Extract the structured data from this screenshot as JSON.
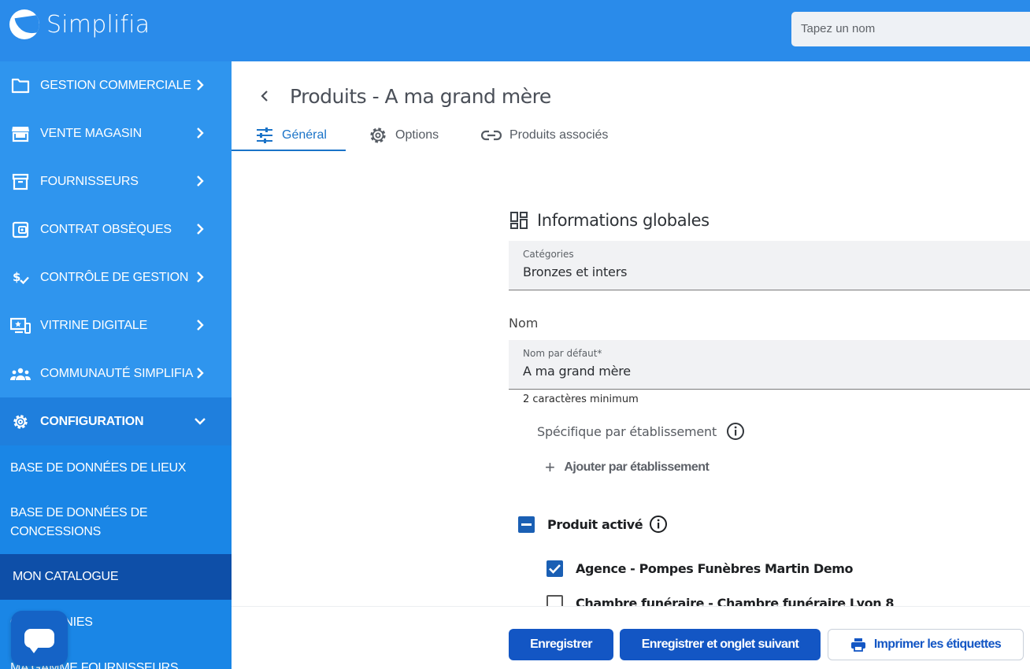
{
  "app": {
    "name": "Simplifia"
  },
  "search": {
    "placeholder": "Tapez un nom"
  },
  "sidebar": {
    "items": [
      {
        "label": "GESTION COMMERCIALE"
      },
      {
        "label": "VENTE MAGASIN"
      },
      {
        "label": "FOURNISSEURS"
      },
      {
        "label": "CONTRAT OBSÈQUES"
      },
      {
        "label": "CONTRÔLE DE GESTION"
      },
      {
        "label": "VITRINE DIGITALE"
      },
      {
        "label": "COMMUNAUTÉ SIMPLIFIA"
      },
      {
        "label": "CONFIGURATION"
      }
    ],
    "sub_items": [
      {
        "label": "BASE DE DONNÉES DE LIEUX"
      },
      {
        "label": "BASE DE DONNÉES DE CONCESSIONS"
      },
      {
        "label": "MON CATALOGUE"
      },
      {
        "label": "CÉRÉMONIES"
      },
      {
        "label": "MA GAMME FOURNISSEURS"
      }
    ]
  },
  "page": {
    "title": "Produits - A ma grand mère",
    "tabs": [
      {
        "label": "Général"
      },
      {
        "label": "Options"
      },
      {
        "label": "Produits associés"
      }
    ]
  },
  "form": {
    "section_title": "Informations globales",
    "categories": {
      "label": "Catégories",
      "value": "Bronzes et inters"
    },
    "nom_label": "Nom",
    "nom_defaut": {
      "label": "Nom par défaut*",
      "value": "A ma grand mère",
      "hint": "2 caractères minimum"
    },
    "specific_label": "Spécifique par établissement",
    "add_label": "Ajouter par établissement",
    "active": {
      "label": "Produit activé",
      "items": [
        {
          "label": "Agence - Pompes Funèbres Martin Demo",
          "checked": true
        },
        {
          "label": "Chambre funéraire - Chambre funéraire Lyon 8",
          "checked": false
        }
      ]
    }
  },
  "footer": {
    "save": "Enregistrer",
    "save_next": "Enregistrer et onglet suivant",
    "print": "Imprimer les étiquettes"
  },
  "colors": {
    "topbar": "#2a8bea",
    "sidebar": "#2f95ee",
    "active_sub": "#0e4fa8",
    "primary": "#1356c4"
  }
}
